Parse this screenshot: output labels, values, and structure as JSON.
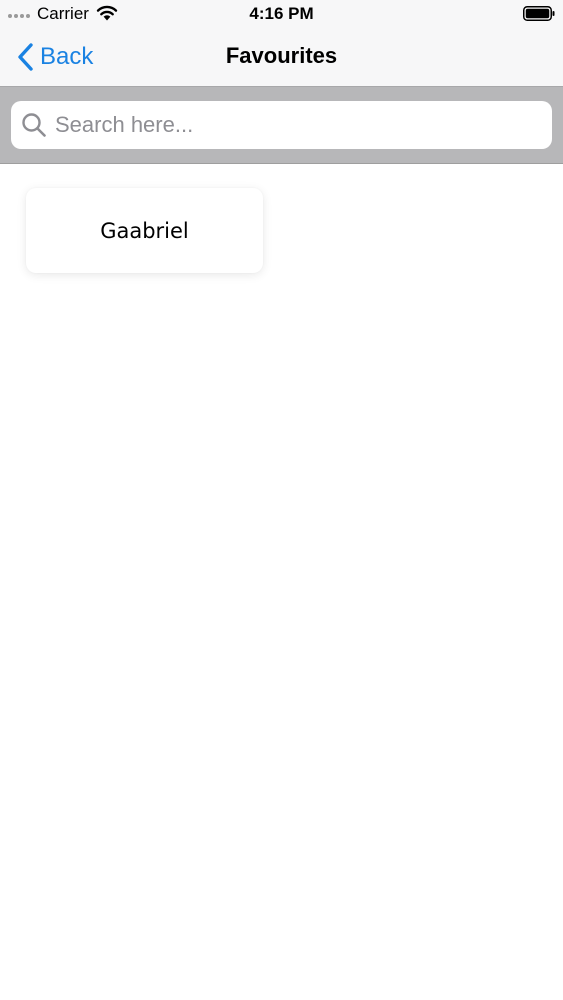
{
  "status_bar": {
    "carrier": "Carrier",
    "time": "4:16 PM"
  },
  "nav": {
    "back_label": "Back",
    "title": "Favourites"
  },
  "search": {
    "placeholder": "Search here...",
    "value": ""
  },
  "favourites": [
    {
      "name": "Gaabriel"
    }
  ],
  "colors": {
    "accent": "#1a82e2",
    "search_bar_bg": "#b7b7b9",
    "nav_bg": "#f7f7f8"
  },
  "icons": {
    "back": "chevron-left-icon",
    "search": "search-icon",
    "wifi": "wifi-icon",
    "battery": "battery-icon"
  }
}
